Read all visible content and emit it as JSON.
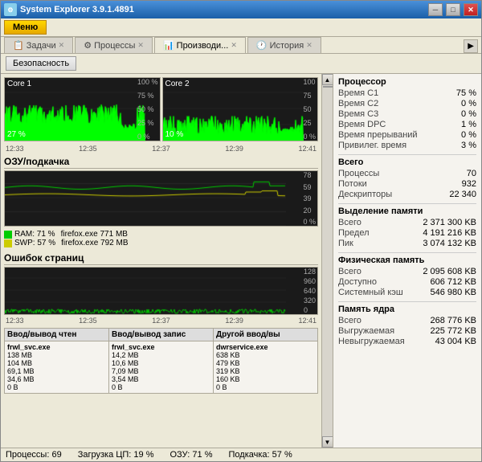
{
  "window": {
    "title": "System Explorer 3.9.1.4891",
    "min_btn": "─",
    "max_btn": "□",
    "close_btn": "✕"
  },
  "menu": {
    "menu_label": "Меню"
  },
  "toolbar": {
    "security_label": "Безопасность"
  },
  "tabs": [
    {
      "id": "tasks",
      "label": "Задачи",
      "active": false
    },
    {
      "id": "processes",
      "label": "Процессы",
      "active": false
    },
    {
      "id": "performance",
      "label": "Производи...",
      "active": true
    },
    {
      "id": "history",
      "label": "История",
      "active": false
    }
  ],
  "cores": [
    {
      "name": "Core 1",
      "pct": "27 %"
    },
    {
      "name": "Core 2",
      "pct": "10 %"
    }
  ],
  "chart_x_labels": [
    "12:33",
    "12:35",
    "12:37",
    "12:39",
    "12:41"
  ],
  "chart_y_labels_cpu": [
    "100 %",
    "75 %",
    "50 %",
    "25 %",
    "0 %"
  ],
  "section_ram": "ОЗУ/подкачка",
  "ram_legend": [
    {
      "color": "#00cc00",
      "label": "RAM: 71 %",
      "sub": "firefox.exe 771 MB"
    },
    {
      "color": "#cccc00",
      "label": "SWP: 57 %",
      "sub": "firefox.exe 792 MB"
    }
  ],
  "chart_y_labels_ram": [
    "78",
    "59",
    "39",
    "20",
    "0 %"
  ],
  "section_pagefault": "Ошибок страниц",
  "chart_y_labels_pf": [
    "128",
    "960",
    "640",
    "320",
    "0"
  ],
  "section_io": "Ввод/вывод чтен",
  "io_headers": [
    "Ввод/вывод чтен",
    "Ввод/вывод запис",
    "Другой ввод/вы"
  ],
  "io_columns": [
    {
      "processes": [
        "frwl_svc.exe",
        "",
        "",
        "",
        ""
      ],
      "values": [
        "138 MB",
        "104 MB",
        "69,1 MB",
        "34,6 MB",
        "0 B"
      ]
    },
    {
      "processes": [
        "frwl_svc.exe",
        "",
        "",
        "",
        ""
      ],
      "values": [
        "14,2 MB",
        "10,6 MB",
        "7,09 MB",
        "3,54 MB",
        "0 B"
      ]
    },
    {
      "processes": [
        "dwrservice.exe",
        "",
        "",
        "",
        ""
      ],
      "values": [
        "638 KB",
        "479 KB",
        "319 KB",
        "160 KB",
        "0 B"
      ]
    }
  ],
  "io_col1": {
    "header": "Ввод/вывод чтен",
    "p1": "frwl_svc.exe",
    "v1": "138 MB",
    "v2": "104 MB",
    "v3": "69,1 MB",
    "v4": "34,6 MB",
    "v5": "0 B"
  },
  "io_col2": {
    "header": "Ввод/вывод запис",
    "p1": "frwl_svc.exe",
    "v1": "14,2 MB",
    "v2": "10,6 MB",
    "v3": "7,09 MB",
    "v4": "3,54 MB",
    "v5": "0 B"
  },
  "io_col3": {
    "header": "Другой ввод/вы",
    "p1": "dwrservice.exe",
    "v1": "638 KB",
    "v2": "479 KB",
    "v3": "319 KB",
    "v4": "160 KB",
    "v5": "0 B"
  },
  "right": {
    "processor_label": "Процессор",
    "rows_cpu": [
      {
        "label": "Время С1",
        "value": "75 %"
      },
      {
        "label": "Время С2",
        "value": "0 %"
      },
      {
        "label": "Время С3",
        "value": "0 %"
      },
      {
        "label": "Время DPC",
        "value": "1 %"
      },
      {
        "label": "Время прерываний",
        "value": "0 %"
      },
      {
        "label": "Привилег. время",
        "value": "3 %"
      }
    ],
    "total_label": "Всего",
    "rows_total": [
      {
        "label": "Процессы",
        "value": "70"
      },
      {
        "label": "Потоки",
        "value": "932"
      },
      {
        "label": "Дескрипторы",
        "value": "22 340"
      }
    ],
    "vmem_label": "Выделение памяти",
    "rows_vmem": [
      {
        "label": "Всего",
        "value": "2 371 300 KB"
      },
      {
        "label": "Предел",
        "value": "4 191 216 KB"
      },
      {
        "label": "Пик",
        "value": "3 074 132 KB"
      }
    ],
    "phys_label": "Физическая память",
    "rows_phys": [
      {
        "label": "Всего",
        "value": "2 095 608 KB"
      },
      {
        "label": "Доступно",
        "value": "606 712 KB"
      },
      {
        "label": "Системный кэш",
        "value": "546 980 KB"
      }
    ],
    "kernel_label": "Память ядра",
    "rows_kernel": [
      {
        "label": "Всего",
        "value": "268 776 KB"
      },
      {
        "label": "Выгружаемая",
        "value": "225 772 KB"
      },
      {
        "label": "Невыгружаемая",
        "value": "43 004 KB"
      }
    ]
  },
  "status": {
    "processes": "Процессы: 69",
    "cpu_load": "Загрузка ЦП: 19 %",
    "ram": "ОЗУ: 71 %",
    "swap": "Подкачка: 57 %"
  }
}
